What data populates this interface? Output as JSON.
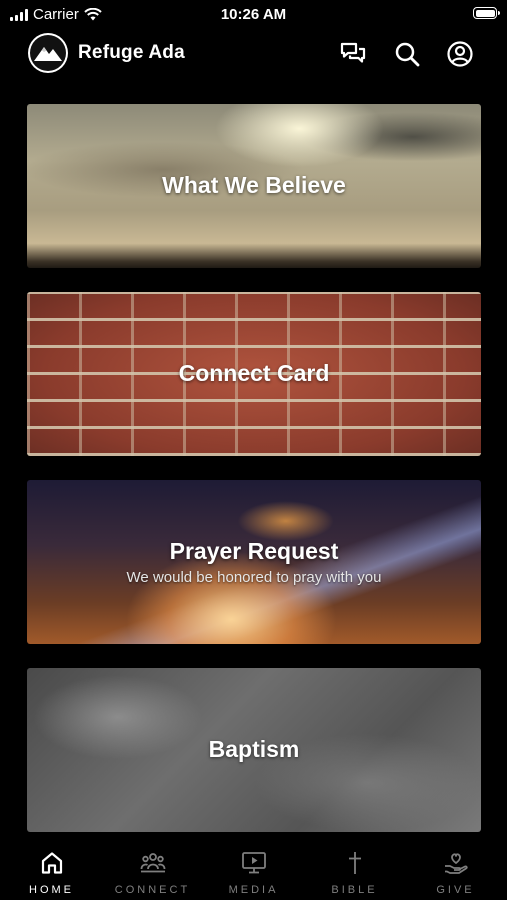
{
  "status_bar": {
    "carrier": "Carrier",
    "time": "10:26 AM"
  },
  "header": {
    "title": "Refuge Ada"
  },
  "cards": [
    {
      "title": "What We Believe",
      "subtitle": ""
    },
    {
      "title": "Connect Card",
      "subtitle": ""
    },
    {
      "title": "Prayer Request",
      "subtitle": "We would be honored to pray with you"
    },
    {
      "title": "Baptism",
      "subtitle": ""
    }
  ],
  "tabs": [
    {
      "label": "HOME",
      "icon": "home-icon",
      "active": true
    },
    {
      "label": "CONNECT",
      "icon": "group-icon",
      "active": false
    },
    {
      "label": "MEDIA",
      "icon": "media-icon",
      "active": false
    },
    {
      "label": "BIBLE",
      "icon": "cross-icon",
      "active": false
    },
    {
      "label": "GIVE",
      "icon": "give-hand-icon",
      "active": false
    }
  ],
  "colors": {
    "background": "#000000",
    "text": "#ffffff",
    "inactive_tab": "#7f7f7f"
  }
}
